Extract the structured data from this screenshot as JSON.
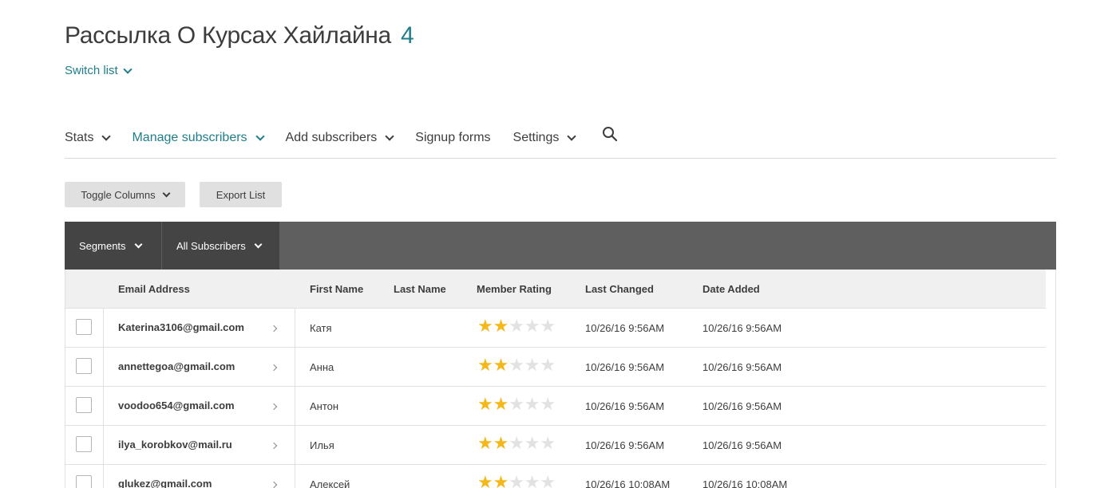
{
  "header": {
    "title": "Рассылка О Курсах Хайлайна",
    "count": "4",
    "switch_label": "Switch list"
  },
  "nav": {
    "items": [
      {
        "label": "Stats",
        "dropdown": true,
        "active": false
      },
      {
        "label": "Manage subscribers",
        "dropdown": true,
        "active": true
      },
      {
        "label": "Add subscribers",
        "dropdown": true,
        "active": false
      },
      {
        "label": "Signup forms",
        "dropdown": false,
        "active": false
      },
      {
        "label": "Settings",
        "dropdown": true,
        "active": false
      }
    ],
    "search_icon": "search-icon"
  },
  "toolbar": {
    "toggle_columns_label": "Toggle Columns",
    "export_list_label": "Export List"
  },
  "segment_bar": {
    "segments_label": "Segments",
    "filter_label": "All Subscribers"
  },
  "table": {
    "columns": [
      "Email Address",
      "First Name",
      "Last Name",
      "Member Rating",
      "Last Changed",
      "Date Added"
    ],
    "rows": [
      {
        "email": "Katerina3106@gmail.com",
        "first_name": "Катя",
        "last_name": "",
        "rating": 2,
        "last_changed": "10/26/16 9:56AM",
        "date_added": "10/26/16 9:56AM"
      },
      {
        "email": "annettegoa@gmail.com",
        "first_name": "Анна",
        "last_name": "",
        "rating": 2,
        "last_changed": "10/26/16 9:56AM",
        "date_added": "10/26/16 9:56AM"
      },
      {
        "email": "voodoo654@gmail.com",
        "first_name": "Антон",
        "last_name": "",
        "rating": 2,
        "last_changed": "10/26/16 9:56AM",
        "date_added": "10/26/16 9:56AM"
      },
      {
        "email": "ilya_korobkov@mail.ru",
        "first_name": "Илья",
        "last_name": "",
        "rating": 2,
        "last_changed": "10/26/16 9:56AM",
        "date_added": "10/26/16 9:56AM"
      },
      {
        "email": "glukez@gmail.com",
        "first_name": "Алексей",
        "last_name": "",
        "rating": 2,
        "last_changed": "10/26/16 10:08AM",
        "date_added": "10/26/16 10:08AM"
      }
    ],
    "rating_max": 5
  },
  "colors": {
    "accent": "#1f7e8a",
    "star_on": "#f5b81b",
    "star_off": "#e2e2e2",
    "segbar_bg": "#5f5f5f",
    "segbtn_bg": "#444444"
  }
}
